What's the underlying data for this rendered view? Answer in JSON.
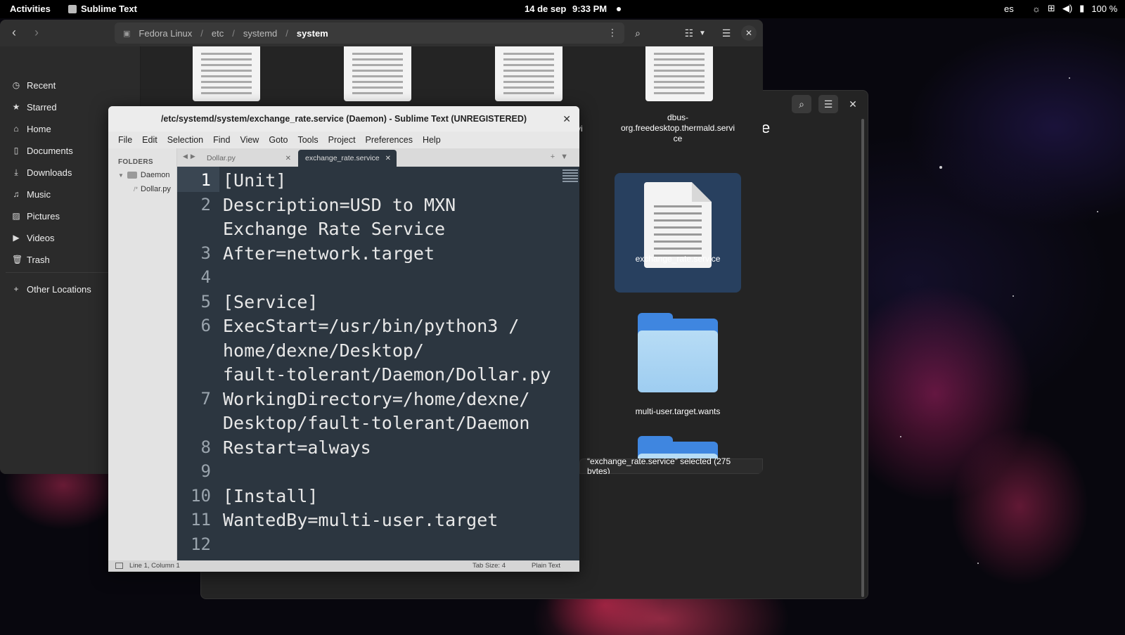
{
  "topbar": {
    "activities": "Activities",
    "app_name": "Sublime Text",
    "date": "14 de sep",
    "time": "9:33 PM",
    "lang": "es",
    "battery": "100 %"
  },
  "files": {
    "path": [
      "Fedora Linux",
      "etc",
      "systemd",
      "system"
    ],
    "path_sep": "/",
    "sidebar": [
      {
        "label": "Recent",
        "icon": "clock-icon"
      },
      {
        "label": "Starred",
        "icon": "star-icon"
      },
      {
        "label": "Home",
        "icon": "home-icon"
      },
      {
        "label": "Documents",
        "icon": "document-icon"
      },
      {
        "label": "Downloads",
        "icon": "download-icon"
      },
      {
        "label": "Music",
        "icon": "music-icon"
      },
      {
        "label": "Pictures",
        "icon": "picture-icon"
      },
      {
        "label": "Videos",
        "icon": "video-icon"
      },
      {
        "label": "Trash",
        "icon": "trash-icon"
      },
      {
        "label": "Other Locations",
        "icon": "plus-icon"
      }
    ],
    "grid": {
      "dbus_label": "dbus-\norg.freedesktop.thermald.servi\nce",
      "partial_label": "vi",
      "selected_label": "exchange_rate.service",
      "folder_label": "multi-user.target.wants"
    },
    "status": "“exchange_rate.service” selected  (275 bytes)"
  },
  "bg_window": {
    "peek_char": "e"
  },
  "sublime": {
    "title": "/etc/systemd/system/exchange_rate.service (Daemon) - Sublime Text (UNREGISTERED)",
    "menu": [
      "File",
      "Edit",
      "Selection",
      "Find",
      "View",
      "Goto",
      "Tools",
      "Project",
      "Preferences",
      "Help"
    ],
    "folders_header": "FOLDERS",
    "tree": {
      "folder": "Daemon",
      "file": "Dollar.py"
    },
    "tabs": [
      {
        "label": "Dollar.py",
        "active": false
      },
      {
        "label": "exchange_rate.service",
        "active": true
      }
    ],
    "lines": [
      {
        "n": "1",
        "text": "[Unit]"
      },
      {
        "n": "2",
        "text": "Description=USD to MXN"
      },
      {
        "n": "",
        "text": "Exchange Rate Service"
      },
      {
        "n": "3",
        "text": "After=network.target"
      },
      {
        "n": "4",
        "text": ""
      },
      {
        "n": "5",
        "text": "[Service]"
      },
      {
        "n": "6",
        "text": "ExecStart=/usr/bin/python3 /"
      },
      {
        "n": "",
        "text": "home/dexne/Desktop/"
      },
      {
        "n": "",
        "text": "fault-tolerant/Daemon/Dollar.py"
      },
      {
        "n": "7",
        "text": "WorkingDirectory=/home/dexne/"
      },
      {
        "n": "",
        "text": "Desktop/fault-tolerant/Daemon"
      },
      {
        "n": "8",
        "text": "Restart=always"
      },
      {
        "n": "9",
        "text": ""
      },
      {
        "n": "10",
        "text": "[Install]"
      },
      {
        "n": "11",
        "text": "WantedBy=multi-user.target"
      },
      {
        "n": "12",
        "text": ""
      }
    ],
    "status_left": "Line 1, Column 1",
    "tab_size": "Tab Size: 4",
    "syntax": "Plain Text"
  }
}
